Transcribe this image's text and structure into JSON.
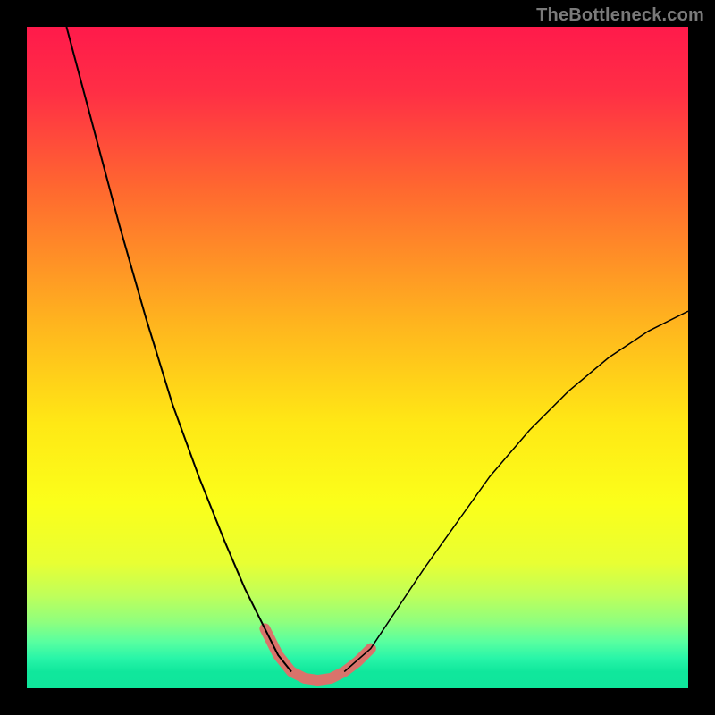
{
  "watermark": "TheBottleneck.com",
  "chart_data": {
    "type": "line",
    "title": "",
    "xlabel": "",
    "ylabel": "",
    "xlim": [
      0,
      100
    ],
    "ylim": [
      0,
      100
    ],
    "background_gradient_stops": [
      {
        "pos": 0.0,
        "color": "#ff1a4b"
      },
      {
        "pos": 0.1,
        "color": "#ff2f45"
      },
      {
        "pos": 0.25,
        "color": "#ff6a2f"
      },
      {
        "pos": 0.45,
        "color": "#ffb51e"
      },
      {
        "pos": 0.6,
        "color": "#ffe815"
      },
      {
        "pos": 0.72,
        "color": "#fbff1a"
      },
      {
        "pos": 0.81,
        "color": "#e8ff33"
      },
      {
        "pos": 0.86,
        "color": "#bfff5a"
      },
      {
        "pos": 0.9,
        "color": "#8fff7e"
      },
      {
        "pos": 0.93,
        "color": "#58ffa0"
      },
      {
        "pos": 0.955,
        "color": "#28f5a8"
      },
      {
        "pos": 0.975,
        "color": "#10e79c"
      },
      {
        "pos": 1.0,
        "color": "#0fe69b"
      }
    ],
    "series": [
      {
        "name": "left-arm",
        "stroke": "#000000",
        "stroke_width": 2,
        "x": [
          6,
          10,
          14,
          18,
          22,
          26,
          30,
          33,
          36,
          38,
          40
        ],
        "y": [
          100,
          85,
          70,
          56,
          43,
          32,
          22,
          15,
          9,
          5,
          2.5
        ]
      },
      {
        "name": "right-arm",
        "stroke": "#000000",
        "stroke_width": 1.5,
        "x": [
          48,
          52,
          56,
          60,
          65,
          70,
          76,
          82,
          88,
          94,
          100
        ],
        "y": [
          2.5,
          6,
          12,
          18,
          25,
          32,
          39,
          45,
          50,
          54,
          57
        ]
      },
      {
        "name": "valley-highlight",
        "stroke": "#d9736b",
        "stroke_width": 12,
        "linecap": "round",
        "x": [
          36,
          38,
          40,
          42,
          44,
          46,
          48,
          50,
          52
        ],
        "y": [
          9,
          5,
          2.5,
          1.5,
          1.2,
          1.5,
          2.5,
          4,
          6
        ]
      }
    ]
  }
}
